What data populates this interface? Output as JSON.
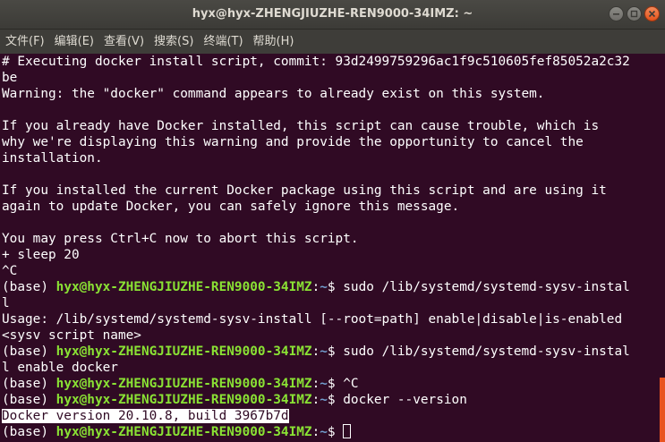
{
  "window": {
    "title": "hyx@hyx-ZHENGJIUZHE-REN9000-34IMZ: ~"
  },
  "menu": {
    "items": [
      "文件(F)",
      "编辑(E)",
      "查看(V)",
      "搜索(S)",
      "终端(T)",
      "帮助(H)"
    ]
  },
  "prompt": {
    "env": "(base) ",
    "user_host": "hyx@hyx-ZHENGJIUZHE-REN9000-34IMZ",
    "colon": ":",
    "path": "~",
    "dollar": "$ "
  },
  "terminal": {
    "lines": {
      "l0": "# Executing docker install script, commit: 93d2499759296ac1f9c510605fef85052a2c32",
      "l1": "be",
      "l2": "Warning: the \"docker\" command appears to already exist on this system.",
      "l3": "",
      "l4": "If you already have Docker installed, this script can cause trouble, which is",
      "l5": "why we're displaying this warning and provide the opportunity to cancel the",
      "l6": "installation.",
      "l7": "",
      "l8": "If you installed the current Docker package using this script and are using it",
      "l9": "again to update Docker, you can safely ignore this message.",
      "l10": "",
      "l11": "You may press Ctrl+C now to abort this script.",
      "l12": "+ sleep 20",
      "l13": "^C",
      "l14_cmd": "sudo /lib/systemd/systemd-sysv-instal",
      "l15": "l",
      "l16": "Usage: /lib/systemd/systemd-sysv-install [--root=path] enable|disable|is-enabled",
      "l17": "<sysv script name>",
      "l18_cmd": "sudo /lib/systemd/systemd-sysv-instal",
      "l19": "l enable docker",
      "l20_cmd": "^C",
      "l21_cmd": "docker --version",
      "l22": "Docker version 20.10.8, build 3967b7d"
    }
  },
  "colors": {
    "background": "#300a24",
    "prompt_user": "#8ae234",
    "prompt_path": "#729fcf",
    "scroll_thumb": "#e95420",
    "close_button": "#e5531b"
  }
}
